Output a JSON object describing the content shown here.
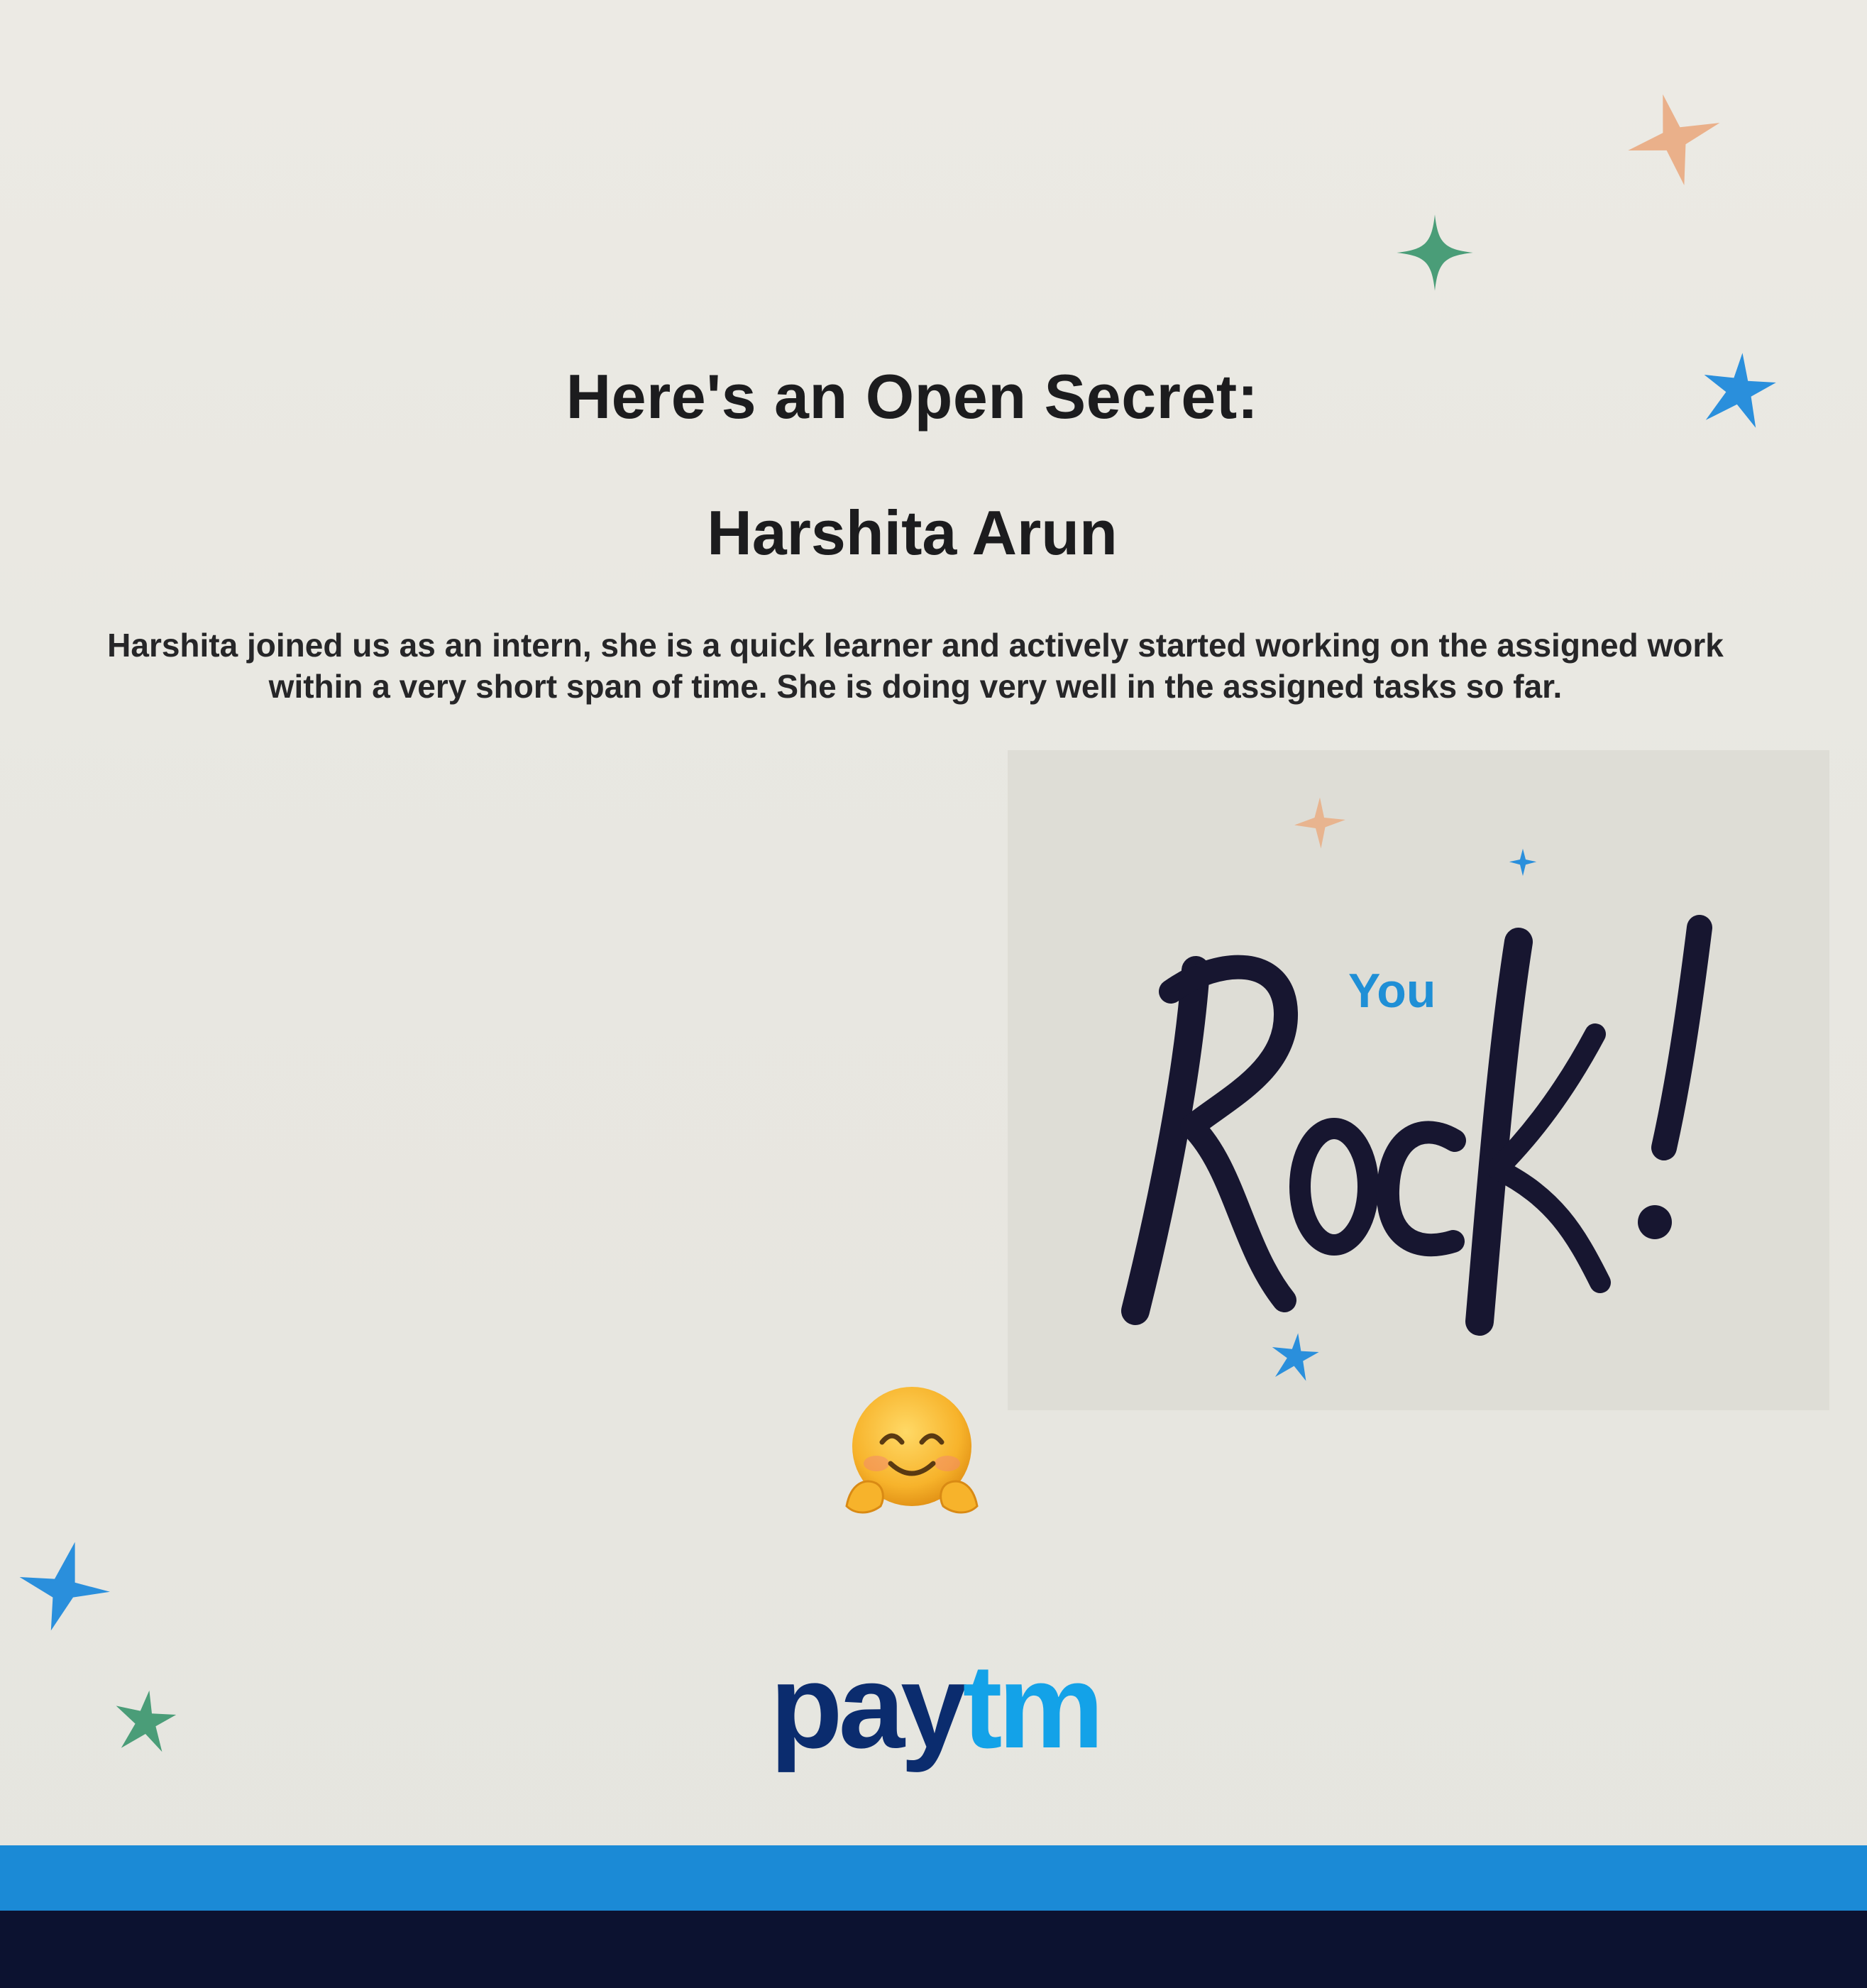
{
  "card": {
    "heading": "Here's an Open Secret:",
    "name": "Harshita Arun",
    "message_line1": "Harshita joined us as an intern, she is a quick learner and actively started working on the assigned work",
    "message_line2": "within a very short span of time. She is doing very well in the assigned tasks so far."
  },
  "badge": {
    "you": "You",
    "rock": "Rock!"
  },
  "logo": {
    "part1": "pay",
    "part2": "tm"
  },
  "colors": {
    "accent_blue": "#1b8ad6",
    "navy": "#0c1230",
    "star_peach": "#e8b48f",
    "star_green": "#4a9d78",
    "star_blue": "#2a8fdc"
  },
  "icons": {
    "emoji": "hugging-face-emoji",
    "stars": "sparkle-star-icon"
  }
}
